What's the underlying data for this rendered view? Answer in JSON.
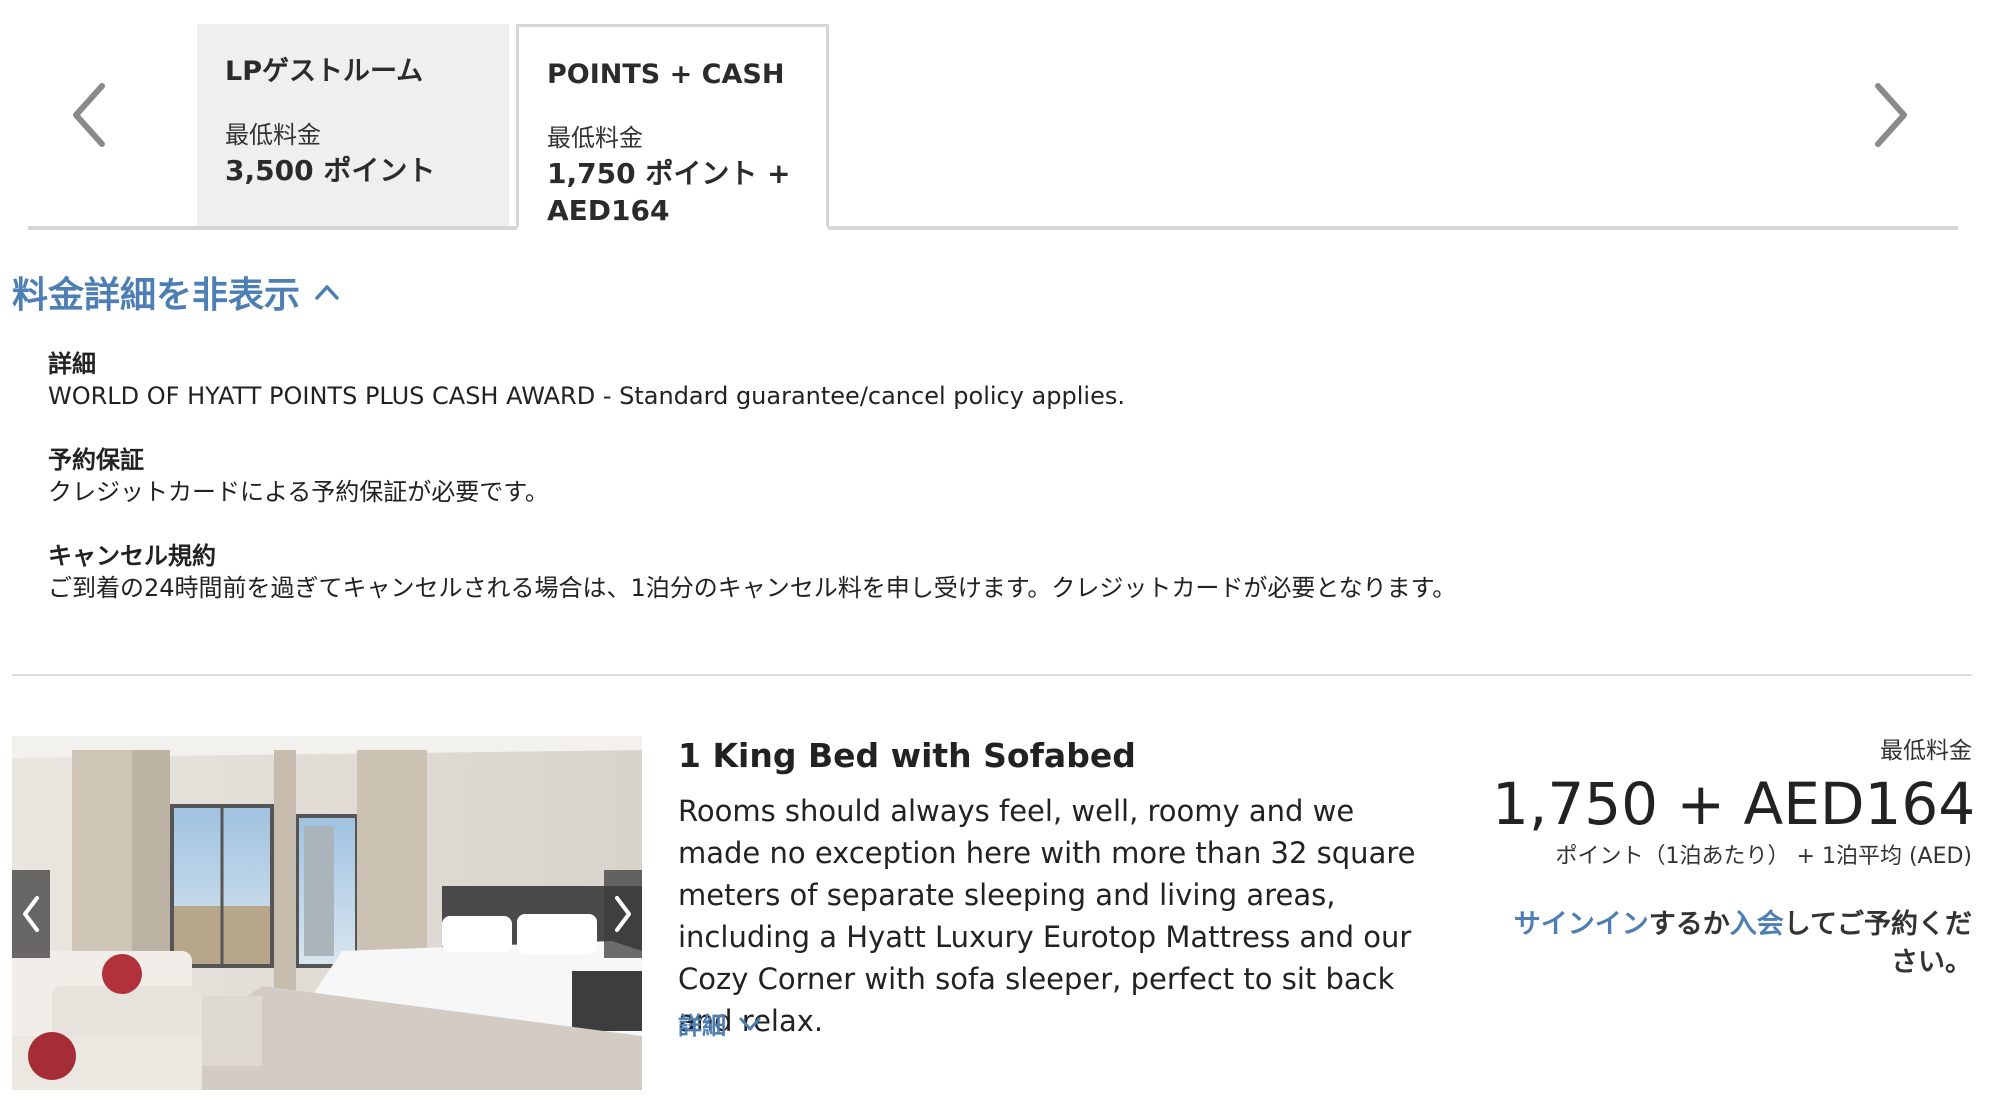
{
  "tabs": [
    {
      "title": "LPゲストルーム",
      "sub_label": "最低料金",
      "price": "3,500 ポイント"
    },
    {
      "title": "POINTS + CASH",
      "sub_label": "最低料金",
      "price": "1,750 ポイント + AED164"
    }
  ],
  "rate_toggle": {
    "label": "料金詳細を非表示"
  },
  "policies": {
    "detail": {
      "heading": "詳細",
      "text": "WORLD OF HYATT POINTS PLUS CASH AWARD - Standard guarantee/cancel policy applies."
    },
    "guarantee": {
      "heading": "予約保証",
      "text": "クレジットカードによる予約保証が必要です。"
    },
    "cancel": {
      "heading": "キャンセル規約",
      "text": "ご到着の24時間前を過ぎてキャンセルされる場合は、1泊分のキャンセル料を申し受けます。クレジットカードが必要となります。"
    }
  },
  "room": {
    "name": "1 King Bed with Sofabed",
    "description": "Rooms should always feel, well, roomy and we made no exception here with more than 32 square meters of separate sleeping and living areas, including a Hyatt Luxury Eurotop Mattress and our Cozy Corner with sofa sleeper,  perfect to sit back and relax.",
    "more_label": "詳細"
  },
  "price": {
    "label": "最低料金",
    "main": "1,750 + AED164",
    "sub": "ポイント（1泊あたり） + 1泊平均 (AED)"
  },
  "signin": {
    "signin_link": "サインイン",
    "text_1": "するか",
    "join_link": "入会",
    "text_2": "してご予約ください。"
  },
  "colors": {
    "link": "#4d7fb4",
    "tab_inactive_bg": "#efefef",
    "border": "#d6d6d6"
  },
  "icons": {
    "prev": "chevron-left-icon",
    "next": "chevron-right-icon",
    "collapse": "chevron-up-icon",
    "expand": "chevron-down-icon"
  }
}
